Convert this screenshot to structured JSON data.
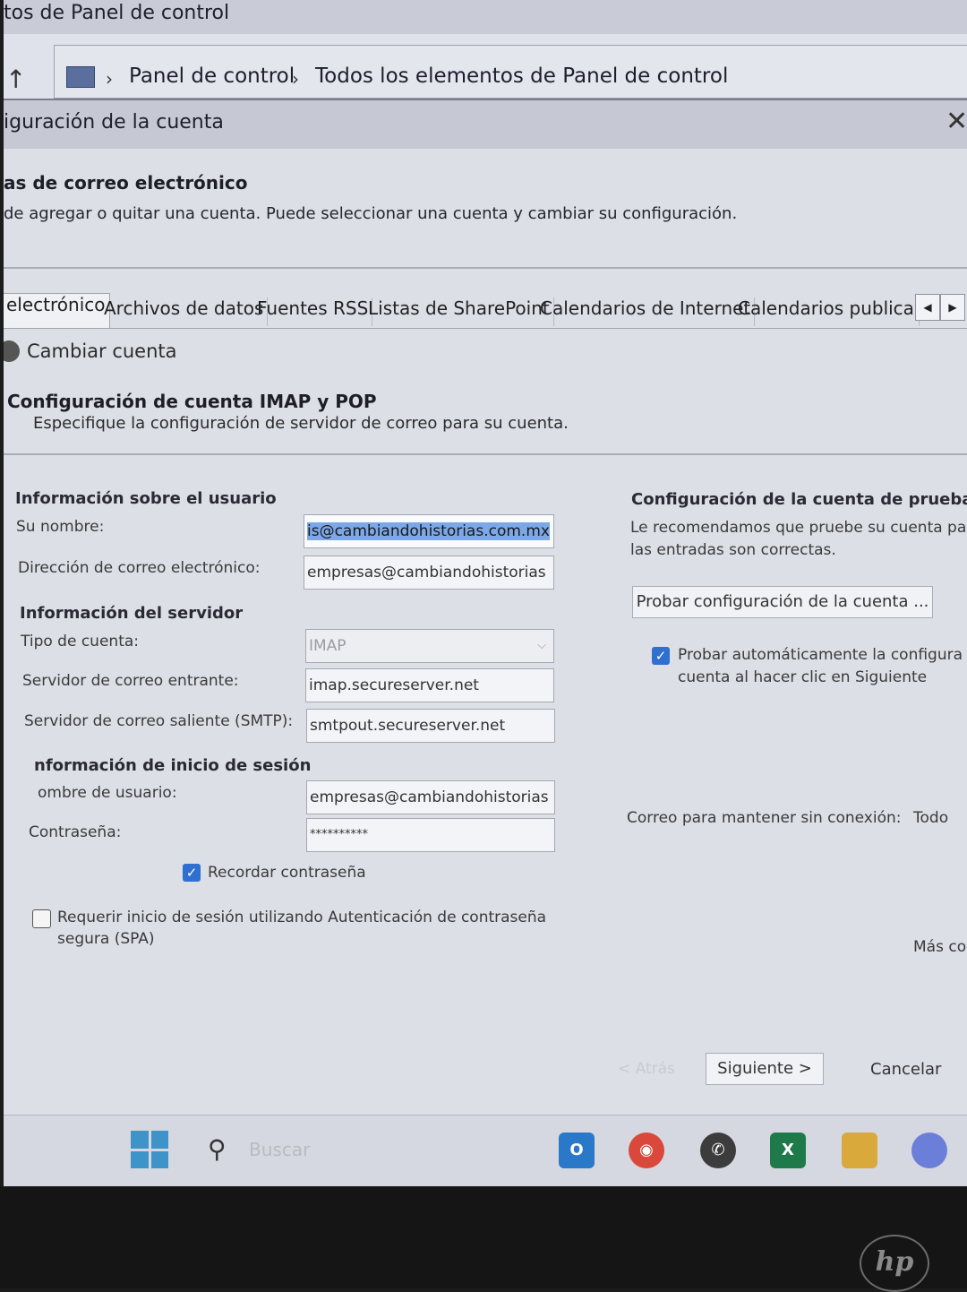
{
  "window": {
    "title": "tos de Panel de control"
  },
  "breadcrumb": {
    "items": [
      "Panel de control",
      "Todos los elementos de Panel de control"
    ]
  },
  "dialog": {
    "title": "iguración de la cuenta",
    "section_title": "as de correo electrónico",
    "section_desc": "de agregar o quitar una cuenta. Puede seleccionar una cuenta y cambiar su configuración."
  },
  "tabs": [
    "electrónico",
    "Archivos de datos",
    "Fuentes RSS",
    "Listas de SharePoint",
    "Calendarios de Internet",
    "Calendarios publicado"
  ],
  "change": {
    "heading": "Cambiar cuenta",
    "title": "Configuración de cuenta IMAP y POP",
    "desc": "Especifique la configuración de servidor de correo para su cuenta."
  },
  "user_info": {
    "heading": "Información sobre el usuario",
    "name_label": "Su nombre:",
    "name_value": "is@cambiandohistorias.com.mx",
    "email_label": "Dirección de correo electrónico:",
    "email_value": "empresas@cambiandohistorias"
  },
  "server_info": {
    "heading": "Información del servidor",
    "type_label": "Tipo de cuenta:",
    "type_value": "IMAP",
    "incoming_label": "Servidor de correo entrante:",
    "incoming_value": "imap.secureserver.net",
    "outgoing_label": "Servidor de correo saliente (SMTP):",
    "outgoing_value": "smtpout.secureserver.net"
  },
  "login_info": {
    "heading": "nformación de inicio de sesión",
    "user_label": "ombre de usuario:",
    "user_value": "empresas@cambiandohistorias",
    "password_label": "Contraseña:",
    "password_value": "**********",
    "remember_label": "Recordar contraseña",
    "remember_checked": true,
    "spa_label_1": "Requerir inicio de sesión utilizando Autenticación de contraseña",
    "spa_label_2": "segura (SPA)",
    "spa_checked": false
  },
  "test": {
    "heading": "Configuración de la cuenta de prueba",
    "desc_1": "Le recomendamos que pruebe su cuenta pa",
    "desc_2": "las entradas son correctas.",
    "button": "Probar configuración de la cuenta ...",
    "auto_label_1": "Probar automáticamente la configura",
    "auto_label_2": "cuenta al hacer clic en Siguiente",
    "auto_checked": true,
    "offline_label": "Correo para mantener sin conexión:",
    "offline_value": "Todo",
    "more": "Más co"
  },
  "footer": {
    "back": "< Atrás",
    "next": "Siguiente >",
    "cancel": "Cancelar"
  },
  "taskbar": {
    "search_placeholder": "Buscar"
  },
  "colors": {
    "accent": "#2f6fd0",
    "selection": "#7da8e8"
  },
  "icons": [
    "arrow-up-icon",
    "control-panel-icon",
    "close-icon",
    "account-icon",
    "windows-start-icon",
    "search-icon",
    "outlook-icon",
    "chrome-icon",
    "whatsapp-icon",
    "excel-icon",
    "file-explorer-icon",
    "copilot-icon",
    "hp-logo"
  ]
}
